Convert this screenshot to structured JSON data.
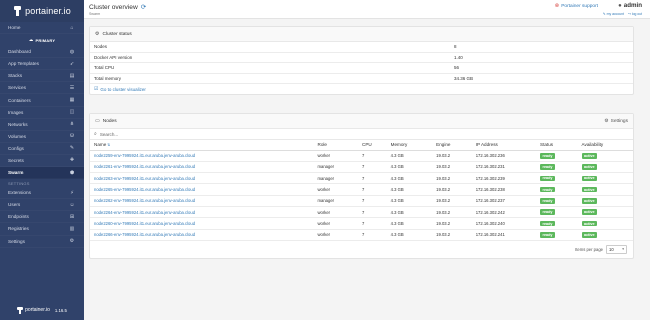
{
  "app": {
    "logo_text": "portainer.io",
    "version": "1.16.5",
    "footer_text": "portainer.io"
  },
  "sidebar": {
    "endpoint_label": "PRIMARY",
    "items": [
      {
        "label": "Home",
        "icon": "home-icon",
        "glyph": "⌂"
      },
      {
        "label": "Dashboard",
        "icon": "dashboard-icon",
        "glyph": "◍"
      },
      {
        "label": "App Templates",
        "icon": "rocket-icon",
        "glyph": "➶"
      },
      {
        "label": "Stacks",
        "icon": "stacks-icon",
        "glyph": "▤"
      },
      {
        "label": "Services",
        "icon": "services-icon",
        "glyph": "☰"
      },
      {
        "label": "Containers",
        "icon": "containers-icon",
        "glyph": "▦"
      },
      {
        "label": "Images",
        "icon": "images-icon",
        "glyph": "◫"
      },
      {
        "label": "Networks",
        "icon": "networks-icon",
        "glyph": "⋔"
      },
      {
        "label": "Volumes",
        "icon": "volumes-icon",
        "glyph": "⛁"
      },
      {
        "label": "Configs",
        "icon": "configs-icon",
        "glyph": "✎"
      },
      {
        "label": "Secrets",
        "icon": "secrets-icon",
        "glyph": "✚"
      },
      {
        "label": "Swarm",
        "icon": "swarm-icon",
        "glyph": "⬢"
      }
    ],
    "settings_section": "SETTINGS",
    "settings_items": [
      {
        "label": "Extensions",
        "icon": "extensions-icon",
        "glyph": "⚡"
      },
      {
        "label": "Users",
        "icon": "users-icon",
        "glyph": "☺"
      },
      {
        "label": "Endpoints",
        "icon": "endpoints-icon",
        "glyph": "⊞"
      },
      {
        "label": "Registries",
        "icon": "registries-icon",
        "glyph": "▥"
      },
      {
        "label": "Settings",
        "icon": "settings-icon",
        "glyph": "⚙"
      }
    ]
  },
  "header": {
    "title": "Cluster overview",
    "subtitle": "Swarm",
    "support_label": "Portainer support",
    "user_label": "admin",
    "my_account": "my account",
    "log_out": "log out"
  },
  "cluster_status": {
    "title": "Cluster status",
    "rows": [
      {
        "key": "Nodes",
        "value": "8"
      },
      {
        "key": "Docker API version",
        "value": "1.40"
      },
      {
        "key": "Total CPU",
        "value": "56"
      },
      {
        "key": "Total memory",
        "value": "34.36 GB"
      }
    ],
    "visualizer_link": "Go to cluster visualizer"
  },
  "nodes": {
    "title": "Nodes",
    "settings_label": "Settings",
    "search_placeholder": "Search...",
    "columns": [
      "Name",
      "Role",
      "CPU",
      "Memory",
      "Engine",
      "IP Address",
      "Status",
      "Availability"
    ],
    "rows": [
      {
        "name": "node2259-env-7995924.it1.eur.aruba.jenv-aruba.cloud",
        "role": "worker",
        "cpu": "7",
        "memory": "4.3 GB",
        "engine": "19.03.2",
        "ip": "172.16.302.236",
        "status": "ready",
        "availability": "active"
      },
      {
        "name": "node2261-env-7995924.it1.eur.aruba.jenv-aruba.cloud",
        "role": "manager",
        "cpu": "7",
        "memory": "4.3 GB",
        "engine": "19.03.2",
        "ip": "172.16.302.231",
        "status": "ready",
        "availability": "active"
      },
      {
        "name": "node2263-env-7995924.it1.eur.aruba.jenv-aruba.cloud",
        "role": "manager",
        "cpu": "7",
        "memory": "4.3 GB",
        "engine": "19.03.2",
        "ip": "172.16.302.239",
        "status": "ready",
        "availability": "active"
      },
      {
        "name": "node2265-env-7995924.it1.eur.aruba.jenv-aruba.cloud",
        "role": "worker",
        "cpu": "7",
        "memory": "4.3 GB",
        "engine": "19.03.2",
        "ip": "172.16.302.238",
        "status": "ready",
        "availability": "active"
      },
      {
        "name": "node2262-env-7995924.it1.eur.aruba.jenv-aruba.cloud",
        "role": "manager",
        "cpu": "7",
        "memory": "4.3 GB",
        "engine": "19.03.2",
        "ip": "172.16.302.237",
        "status": "ready",
        "availability": "active"
      },
      {
        "name": "node2264-env-7995924.it1.eur.aruba.jenv-aruba.cloud",
        "role": "worker",
        "cpu": "7",
        "memory": "4.3 GB",
        "engine": "19.03.2",
        "ip": "172.16.302.242",
        "status": "ready",
        "availability": "active"
      },
      {
        "name": "node2260-env-7995924.it1.eur.aruba.jenv-aruba.cloud",
        "role": "worker",
        "cpu": "7",
        "memory": "4.3 GB",
        "engine": "19.03.2",
        "ip": "172.16.302.240",
        "status": "ready",
        "availability": "active"
      },
      {
        "name": "node2266-env-7995924.it1.eur.aruba.jenv-aruba.cloud",
        "role": "worker",
        "cpu": "7",
        "memory": "4.3 GB",
        "engine": "19.03.2",
        "ip": "172.16.302.241",
        "status": "ready",
        "availability": "active"
      }
    ],
    "items_per_page_label": "Items per page",
    "items_per_page_value": "10"
  },
  "colors": {
    "sidebar_bg": "#30426a",
    "link": "#337ab7",
    "badge_green": "#5cb85c",
    "support_red": "#d9534f"
  }
}
